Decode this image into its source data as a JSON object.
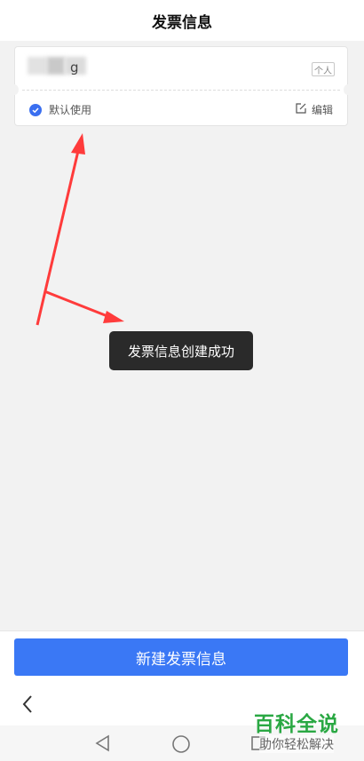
{
  "header": {
    "title": "发票信息"
  },
  "invoice_card": {
    "name_visible": "g",
    "type_tag": "个人",
    "default_label": "默认使用",
    "edit_label": "编辑"
  },
  "toast": {
    "message": "发票信息创建成功"
  },
  "bottom": {
    "new_invoice_label": "新建发票信息"
  },
  "watermark": {
    "title": "百科全说",
    "subtitle": "助你轻松解决"
  },
  "colors": {
    "primary": "#3a78f5",
    "check": "#3a6ff0",
    "annotation_arrow": "#ff3b3b",
    "watermark_green": "#2aa843"
  },
  "icons": {
    "check": "check-circle-icon",
    "edit": "edit-icon",
    "back": "chevron-left-icon",
    "nav_back": "triangle-back-icon",
    "nav_home": "circle-home-icon",
    "nav_recent": "square-recent-icon"
  }
}
